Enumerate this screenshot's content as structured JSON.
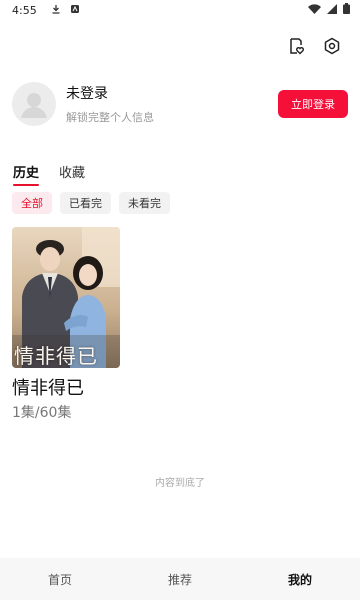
{
  "status_bar": {
    "time": "4:55",
    "left_icons": [
      "download-icon",
      "app-notification-icon"
    ],
    "right_icons": [
      "wifi-icon",
      "signal-icon",
      "battery-icon"
    ]
  },
  "topbar": {
    "icons": [
      "history-heart-icon",
      "settings-hex-icon"
    ]
  },
  "profile": {
    "name": "未登录",
    "subtitle": "解锁完整个人信息",
    "login_button": "立即登录"
  },
  "tabs": [
    {
      "label": "历史",
      "active": true
    },
    {
      "label": "收藏",
      "active": false
    }
  ],
  "filters": [
    {
      "label": "全部",
      "active": true
    },
    {
      "label": "已看完",
      "active": false
    },
    {
      "label": "未看完",
      "active": false
    }
  ],
  "history_items": [
    {
      "title": "情非得已",
      "progress": "1集/60集",
      "poster_text": "情非得已"
    }
  ],
  "end_text": "内容到底了",
  "bottom_nav": [
    {
      "label": "首页",
      "active": false
    },
    {
      "label": "推荐",
      "active": false
    },
    {
      "label": "我的",
      "active": true
    }
  ],
  "colors": {
    "accent": "#f5103a",
    "tab_underline": "#e8112d"
  }
}
